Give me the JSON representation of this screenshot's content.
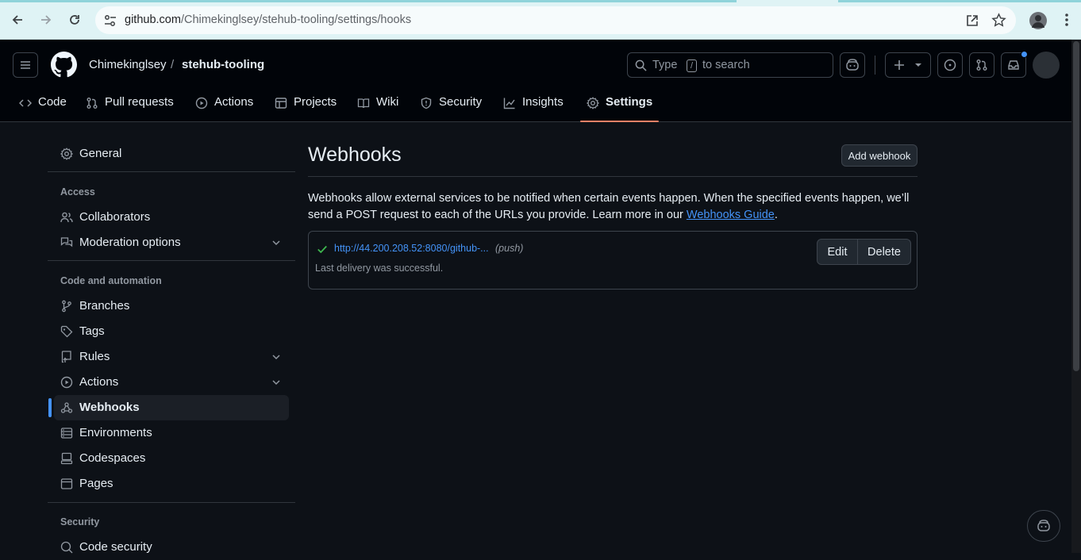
{
  "browser": {
    "url_host": "github.com",
    "url_path": "/Chimekinglsey/stehub-tooling/settings/hooks"
  },
  "header": {
    "owner": "Chimekinglsey",
    "separator": "/",
    "repo": "stehub-tooling",
    "search_prefix": "Type",
    "search_key": "/",
    "search_suffix": "to search"
  },
  "tabs": [
    {
      "label": "Code",
      "icon": "code-icon"
    },
    {
      "label": "Pull requests",
      "icon": "git-pull-request-icon"
    },
    {
      "label": "Actions",
      "icon": "play-icon"
    },
    {
      "label": "Projects",
      "icon": "table-icon"
    },
    {
      "label": "Wiki",
      "icon": "book-icon"
    },
    {
      "label": "Security",
      "icon": "shield-icon"
    },
    {
      "label": "Insights",
      "icon": "graph-icon"
    },
    {
      "label": "Settings",
      "icon": "gear-icon",
      "active": true
    }
  ],
  "sidebar": {
    "general": "General",
    "access_heading": "Access",
    "collaborators": "Collaborators",
    "moderation": "Moderation options",
    "code_heading": "Code and automation",
    "branches": "Branches",
    "tags": "Tags",
    "rules": "Rules",
    "actions": "Actions",
    "webhooks": "Webhooks",
    "environments": "Environments",
    "codespaces": "Codespaces",
    "pages": "Pages",
    "security_heading": "Security",
    "code_security": "Code security"
  },
  "main": {
    "title": "Webhooks",
    "add_button": "Add webhook",
    "description": "Webhooks allow external services to be notified when certain events happen. When the specified events happen, we’ll send a POST request to each of the URLs you provide. Learn more in our ",
    "guide_link": "Webhooks Guide",
    "description_end": ".",
    "hook": {
      "url": "http://44.200.208.52:8080/github-...",
      "event": "(push)",
      "status": "Last delivery was successful.",
      "edit": "Edit",
      "delete": "Delete"
    }
  },
  "colors": {
    "accent": "#4493f8",
    "success": "#3fb950",
    "active_tab": "#f78166",
    "notification_dot": "#4493f8"
  }
}
